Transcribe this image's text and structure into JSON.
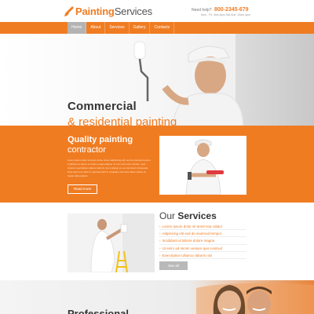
{
  "header": {
    "logo_word1": "Painting",
    "logo_word2": "Services",
    "help_label": "Need help?",
    "phone": "800-2345-679",
    "hours": "Mon - Fri: 9am-6pm  Sat-Sun: 10am-4pm"
  },
  "nav": [
    {
      "label": "Home",
      "active": true
    },
    {
      "label": "About",
      "active": false
    },
    {
      "label": "Services",
      "active": false
    },
    {
      "label": "Gallery",
      "active": false
    },
    {
      "label": "Contacts",
      "active": false
    }
  ],
  "hero": {
    "title_line1": "Commercial",
    "title_line2": "& residential painting",
    "slide_count": 3,
    "active_slide": 1
  },
  "quality": {
    "title_line1": "Quality painting",
    "title_line2": "contractor",
    "body": "Lorem ipsum dolor sit amet conse ctetur adipisicing elit, sed do eiusmod tempor incididunt ut labore et dolore magna aliqua. Ut enim ad minim veniam, quis nostrud exercitation ullamco laboris nisi ut aliquip ex ea commodo consequat. Duis aute irure dolor in reprehenderit in voluptate velit esse cillum dolore eu fugiat nulla pariatur.",
    "button": "Read more"
  },
  "services": {
    "title_prefix": "Our",
    "title_bold": "Services",
    "items": [
      "Lorem ipsum dolor sit amet ena cdatur",
      "Adipiscing elit sed do eiusmod tempor",
      "Incididunt ut labore dolore magna",
      "Ut enim ad minim veniam quis nostrud",
      "Exercitation Ullamco laboris nisi"
    ],
    "button": "See all"
  },
  "bottom": {
    "title": "Professional"
  },
  "colors": {
    "accent": "#f07c22",
    "nav_active": "#b3b3b3"
  }
}
